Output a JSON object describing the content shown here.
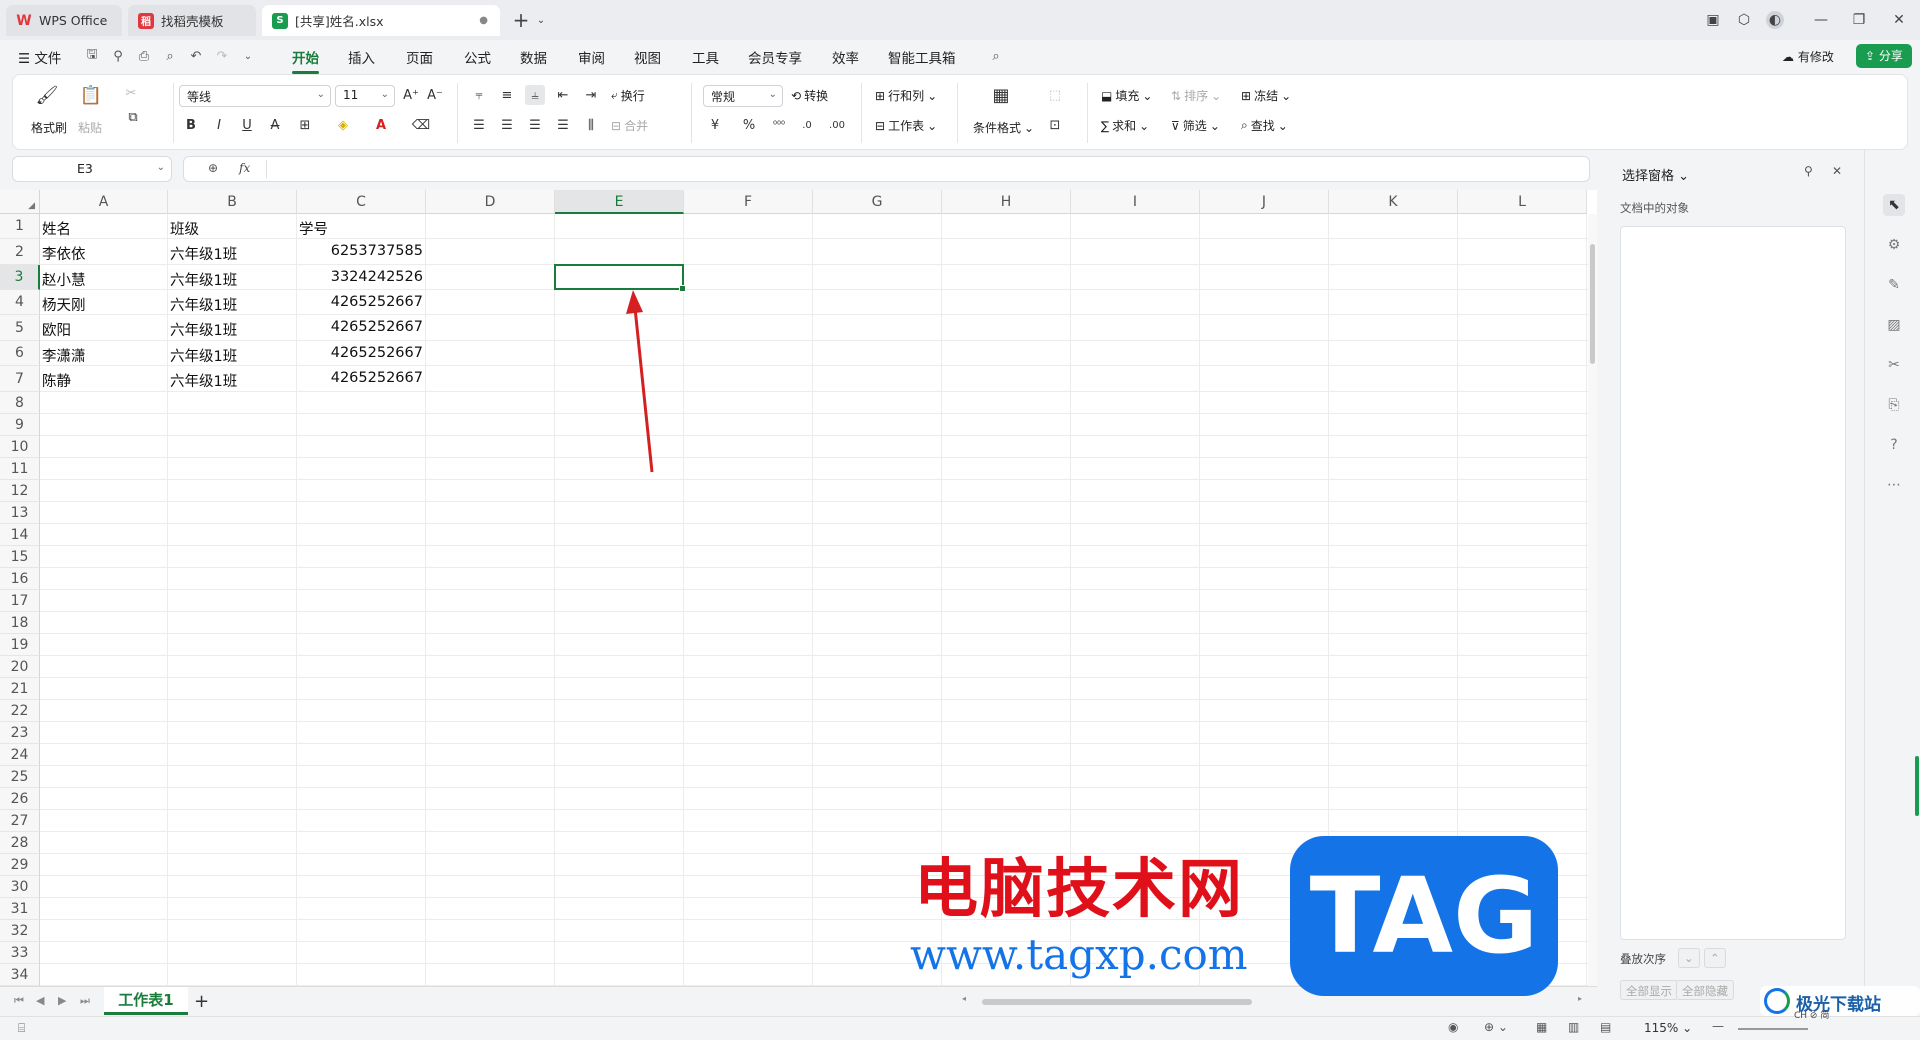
{
  "titlebar": {
    "tabs": [
      {
        "label": "WPS Office",
        "logo": "W",
        "color": "#e0383e"
      },
      {
        "label": "找稻壳模板",
        "logo": "稻",
        "color": "#e0383e"
      },
      {
        "label": "[共享]姓名.xlsx",
        "logo": "S",
        "color": "#1a9c50"
      }
    ],
    "new_tab": "+"
  },
  "menubar": {
    "file": "文件",
    "items": [
      "开始",
      "插入",
      "页面",
      "公式",
      "数据",
      "审阅",
      "视图",
      "工具",
      "会员专享",
      "效率",
      "智能工具箱"
    ],
    "active": "开始",
    "modified": "有修改",
    "share": "分享"
  },
  "ribbon": {
    "format_painter": "格式刷",
    "paste": "粘贴",
    "font_name": "等线",
    "font_size": "11",
    "wrap": "换行",
    "merge": "合并",
    "number_format": "常规",
    "convert": "转换",
    "rows_cols": "行和列",
    "worksheet": "工作表",
    "cond_format": "条件格式",
    "fill": "填充",
    "sort": "排序",
    "freeze": "冻结",
    "sum": "求和",
    "filter": "筛选",
    "find": "查找",
    "bold": "B",
    "italic": "I",
    "underline": "U",
    "strike": "A"
  },
  "formula": {
    "name_box": "E3",
    "fx": "fx",
    "value": ""
  },
  "sheet": {
    "columns": [
      "A",
      "B",
      "C",
      "D",
      "E",
      "F",
      "G",
      "H",
      "I",
      "J",
      "K",
      "L"
    ],
    "selected_column": "E",
    "selected_row": "3",
    "rows": [
      "1",
      "2",
      "3",
      "4",
      "5",
      "6",
      "7",
      "8",
      "9",
      "10",
      "11",
      "12",
      "13",
      "14",
      "15",
      "16",
      "17",
      "18",
      "19",
      "20",
      "21",
      "22",
      "23",
      "24",
      "25",
      "26",
      "27",
      "28",
      "29",
      "30",
      "31",
      "32",
      "33",
      "34"
    ],
    "data": [
      [
        "姓名",
        "班级",
        "学号"
      ],
      [
        "李依依",
        "六年级1班",
        "6253737585"
      ],
      [
        "赵小慧",
        "六年级1班",
        "3324242526"
      ],
      [
        "杨天刚",
        "六年级1班",
        "4265252667"
      ],
      [
        "欧阳",
        "六年级1班",
        "4265252667"
      ],
      [
        "李潇潇",
        "六年级1班",
        "4265252667"
      ],
      [
        "陈静",
        "六年级1班",
        "4265252667"
      ]
    ]
  },
  "sheet_tabs": {
    "active": "工作表1",
    "add": "+"
  },
  "status": {
    "zoom": "115%"
  },
  "pane": {
    "title": "选择窗格",
    "subtitle": "文档中的对象",
    "order": "叠放次序",
    "show_all": "全部显示",
    "hide_all": "全部隐藏"
  },
  "watermark": {
    "cn_text": "电脑技术网",
    "url": "www.tagxp.com",
    "badge": "TAG",
    "corner": "极光下载站",
    "ime": "CH ⊘ 简"
  },
  "colors": {
    "accent": "#1a7c3b",
    "arrow": "#d42020",
    "wm_red": "#e0101a",
    "wm_blue": "#1473e6"
  }
}
